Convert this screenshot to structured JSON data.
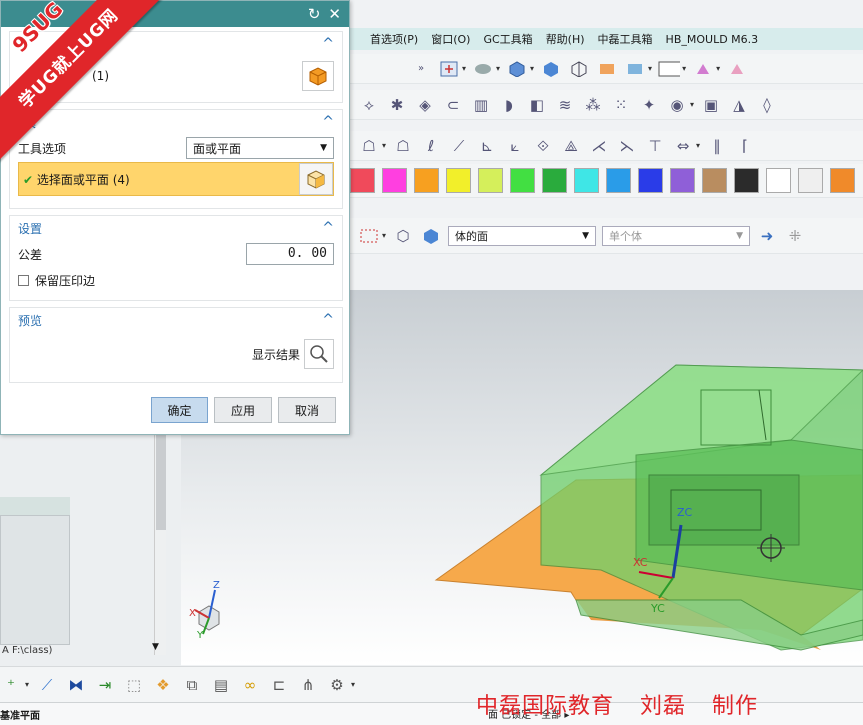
{
  "menubar": {
    "items": [
      "首选项(P)",
      "窗口(O)",
      "GC工具箱",
      "帮助(H)",
      "中磊工具箱",
      "HB_MOULD M6.3"
    ]
  },
  "selection_bar": {
    "filter_value": "体的面",
    "scope_value": "单个体"
  },
  "colors": {
    "swatches": [
      "#f04a5b",
      "#ff3fe0",
      "#f7a020",
      "#f2ef2a",
      "#d5ef5b",
      "#42df42",
      "#2aab3d",
      "#3fe6e6",
      "#2a9ce8",
      "#2a3ce8",
      "#8f5fd8",
      "#b98d60",
      "#2b2b2b",
      "#ffffff",
      "#efefef",
      "#f08a2a"
    ],
    "accent": "#3c8c8f",
    "highlight": "#ffd56c"
  },
  "dialog": {
    "title_icons": [
      "reset-icon",
      "close-icon"
    ],
    "section1": {
      "selection_label": "(1)"
    },
    "section2": {
      "title": "具",
      "tool_option_label": "工具选项",
      "tool_option_value": "面或平面",
      "select_label": "选择面或平面 (4)"
    },
    "settings": {
      "title": "设置",
      "tolerance_label": "公差",
      "tolerance_value": "0. 00",
      "keep_imprint_label": "保留压印边"
    },
    "preview": {
      "title": "预览",
      "show_result_label": "显示结果"
    },
    "buttons": {
      "ok": "确定",
      "apply": "应用",
      "cancel": "取消"
    }
  },
  "ribbon": {
    "top_text": "9SUG",
    "main_text": "学UG就上UG网"
  },
  "left_panel": {
    "path_text": "A F:\\class)"
  },
  "viewport": {
    "axis_labels": {
      "zc": "ZC",
      "xc": "XC",
      "yc": "YC"
    },
    "triad_labels": {
      "z": "Z",
      "x": "X",
      "y": "Y"
    }
  },
  "statusbar": {
    "left_text": "基准平面",
    "message": "面 已锁定 - 全部 ▸"
  },
  "watermark": {
    "org": "中磊国际教育",
    "author": "刘磊",
    "made": "制作"
  }
}
